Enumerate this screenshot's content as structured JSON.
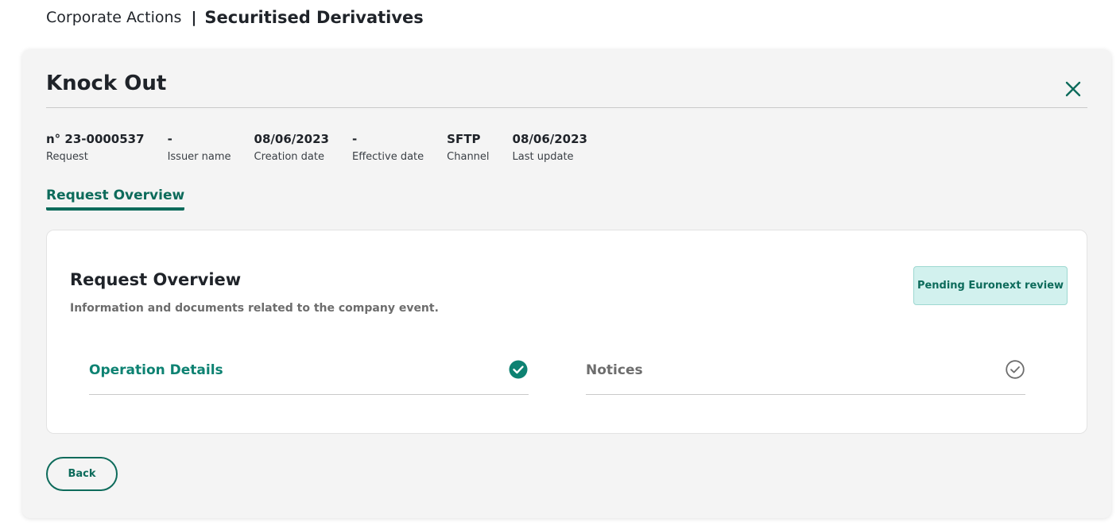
{
  "breadcrumb": {
    "parent": "Corporate Actions",
    "separator": "|",
    "current": "Securitised Derivatives"
  },
  "panel": {
    "title": "Knock Out",
    "close_icon": "close-icon"
  },
  "meta": [
    {
      "value": "n° 23-0000537",
      "label": "Request"
    },
    {
      "value": "-",
      "label": "Issuer name"
    },
    {
      "value": "08/06/2023",
      "label": "Creation date"
    },
    {
      "value": "-",
      "label": "Effective date"
    },
    {
      "value": "SFTP",
      "label": "Channel"
    },
    {
      "value": "08/06/2023",
      "label": "Last update"
    }
  ],
  "tabs": [
    {
      "label": "Request Overview",
      "active": true
    }
  ],
  "card": {
    "title": "Request Overview",
    "subtitle": "Information and documents related to the company event.",
    "status": "Pending Euronext review",
    "sections": [
      {
        "label": "Operation Details",
        "state": "completed",
        "icon": "check-circle-filled-icon"
      },
      {
        "label": "Notices",
        "state": "pending",
        "icon": "check-circle-outline-icon"
      }
    ]
  },
  "actions": {
    "back_label": "Back"
  },
  "colors": {
    "accent": "#0d6b5b",
    "accent_light": "#0d8272",
    "badge_bg": "#d2f1ee",
    "muted": "#6d6d6d"
  }
}
